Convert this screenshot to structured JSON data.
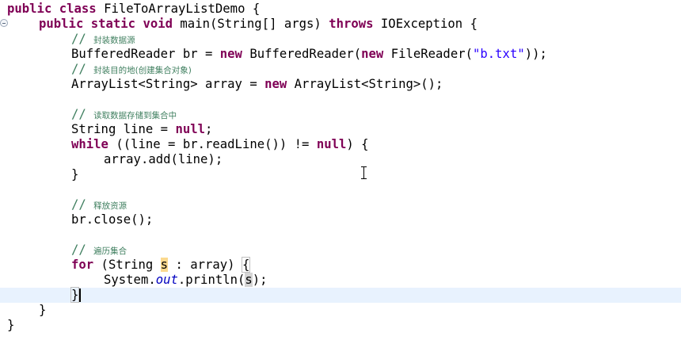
{
  "editor": {
    "class_decl": {
      "kw1": "public",
      "kw2": "class",
      "rest": " FileToArrayListDemo {"
    },
    "main_decl": {
      "kw1": "public",
      "kw2": "static",
      "kw3": "void",
      "mid": " main(String[] args) ",
      "kw4": "throws",
      "rest": " IOException {"
    },
    "comment1": {
      "slash": "// ",
      "text": "封装数据源"
    },
    "reader_line": {
      "pre": "BufferedReader br = ",
      "kw1": "new",
      "mid": " BufferedReader(",
      "kw2": "new",
      "mid2": " FileReader(",
      "str": "\"b.txt\"",
      "rest": "));"
    },
    "comment2": {
      "slash": "// ",
      "text": "封装目的地(创建集合对象)"
    },
    "list_line": {
      "pre": "ArrayList<String> array = ",
      "kw": "new",
      "rest": " ArrayList<String>();"
    },
    "comment3": {
      "slash": "// ",
      "text": "读取数据存储到集合中"
    },
    "string_line": {
      "pre": "String line = ",
      "kw": "null",
      "rest": ";"
    },
    "while_line": {
      "kw1": "while",
      "mid": " ((line = br.readLine()) != ",
      "kw2": "null",
      "rest": ") {"
    },
    "add_line": {
      "text": "array.add(line);"
    },
    "close_brace": "}",
    "comment4": {
      "slash": "// ",
      "text": "释放资源"
    },
    "close_line": {
      "text": "br.close();"
    },
    "comment5": {
      "slash": "// ",
      "text": "遍历集合"
    },
    "for_line": {
      "kw": "for",
      "pre": " (String ",
      "var": "s",
      "mid": " : array) ",
      "brace": "{"
    },
    "println_line": {
      "pre": "System.",
      "field": "out",
      "mid": ".println(",
      "var": "s",
      "rest": ");"
    },
    "end_for": "}",
    "end_main": "}",
    "end_class": "}"
  }
}
